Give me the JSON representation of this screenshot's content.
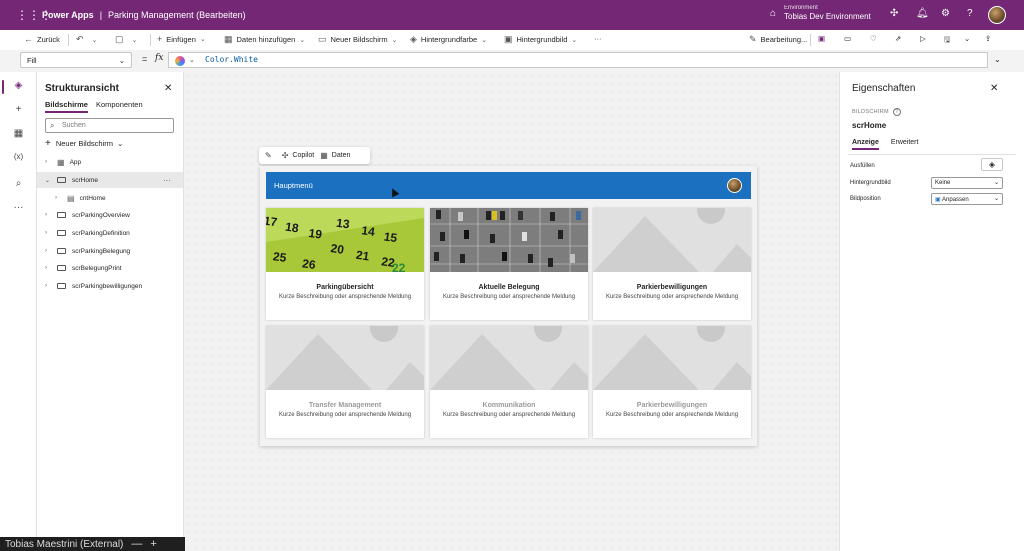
{
  "titlebar": {
    "app_name": "Power Apps",
    "separator": "|",
    "doc_title": "Parking Management (Bearbeiten)",
    "environment_label": "Environment",
    "environment_name": "Tobias Dev Environment"
  },
  "toolbar": {
    "back": "Zurück",
    "insert": "Einfügen",
    "add_data": "Daten hinzufügen",
    "new_screen": "Neuer Bildschirm",
    "background_color": "Hintergrundfarbe",
    "background_image": "Hintergrundbild",
    "more": "···",
    "edit_mode": "Bearbeitung..."
  },
  "formula": {
    "property": "Fill",
    "equals": "=",
    "fx": "fx",
    "value": "Color.White"
  },
  "tree": {
    "title": "Strukturansicht",
    "tabs": [
      "Bildschirme",
      "Komponenten"
    ],
    "search_placeholder": "Suchen",
    "new_screen": "Neuer Bildschirm",
    "items": [
      {
        "label": "App"
      },
      {
        "label": "scrHome"
      },
      {
        "label": "cntHome"
      },
      {
        "label": "scrParkingOverview"
      },
      {
        "label": "scrParkingDefinition"
      },
      {
        "label": "scrParkingBelegung"
      },
      {
        "label": "scrBelegungPrint"
      },
      {
        "label": "scrParkingbewilligungen"
      }
    ]
  },
  "canvas_toolbar": {
    "copilot": "Copilot",
    "data": "Daten"
  },
  "app": {
    "header_title": "Hauptmenü",
    "cards": [
      {
        "title": "Parkingübersicht",
        "desc": "Kurze Beschreibung oder ansprechende Meldung"
      },
      {
        "title": "Aktuelle Belegung",
        "desc": "Kurze Beschreibung oder ansprechende Meldung"
      },
      {
        "title": "Parkierbewilligungen",
        "desc": "Kurze Beschreibung oder ansprechende Meldung"
      },
      {
        "title": "Transfer Management",
        "desc": "Kurze Beschreibung oder ansprechende Meldung"
      },
      {
        "title": "Kommunikation",
        "desc": "Kurze Beschreibung oder ansprechende Meldung"
      },
      {
        "title": "Parkierbewilligungen",
        "desc": "Kurze Beschreibung oder ansprechende Meldung"
      }
    ]
  },
  "props": {
    "title": "Eigenschaften",
    "caption": "BILDSCHIRM",
    "screen_name": "scrHome",
    "tabs": [
      "Anzeige",
      "Erweitert"
    ],
    "fill_label": "Ausfüllen",
    "bgimage_label": "Hintergrundbild",
    "bgimage_value": "Keine",
    "imgpos_label": "Bildposition",
    "imgpos_value": "Anpassen"
  },
  "taskbar": {
    "label": "Tobias Maestrini (External)",
    "minus": "—",
    "plus": "+"
  },
  "colors": {
    "brand": "#742774",
    "header": "#1b71c0"
  }
}
